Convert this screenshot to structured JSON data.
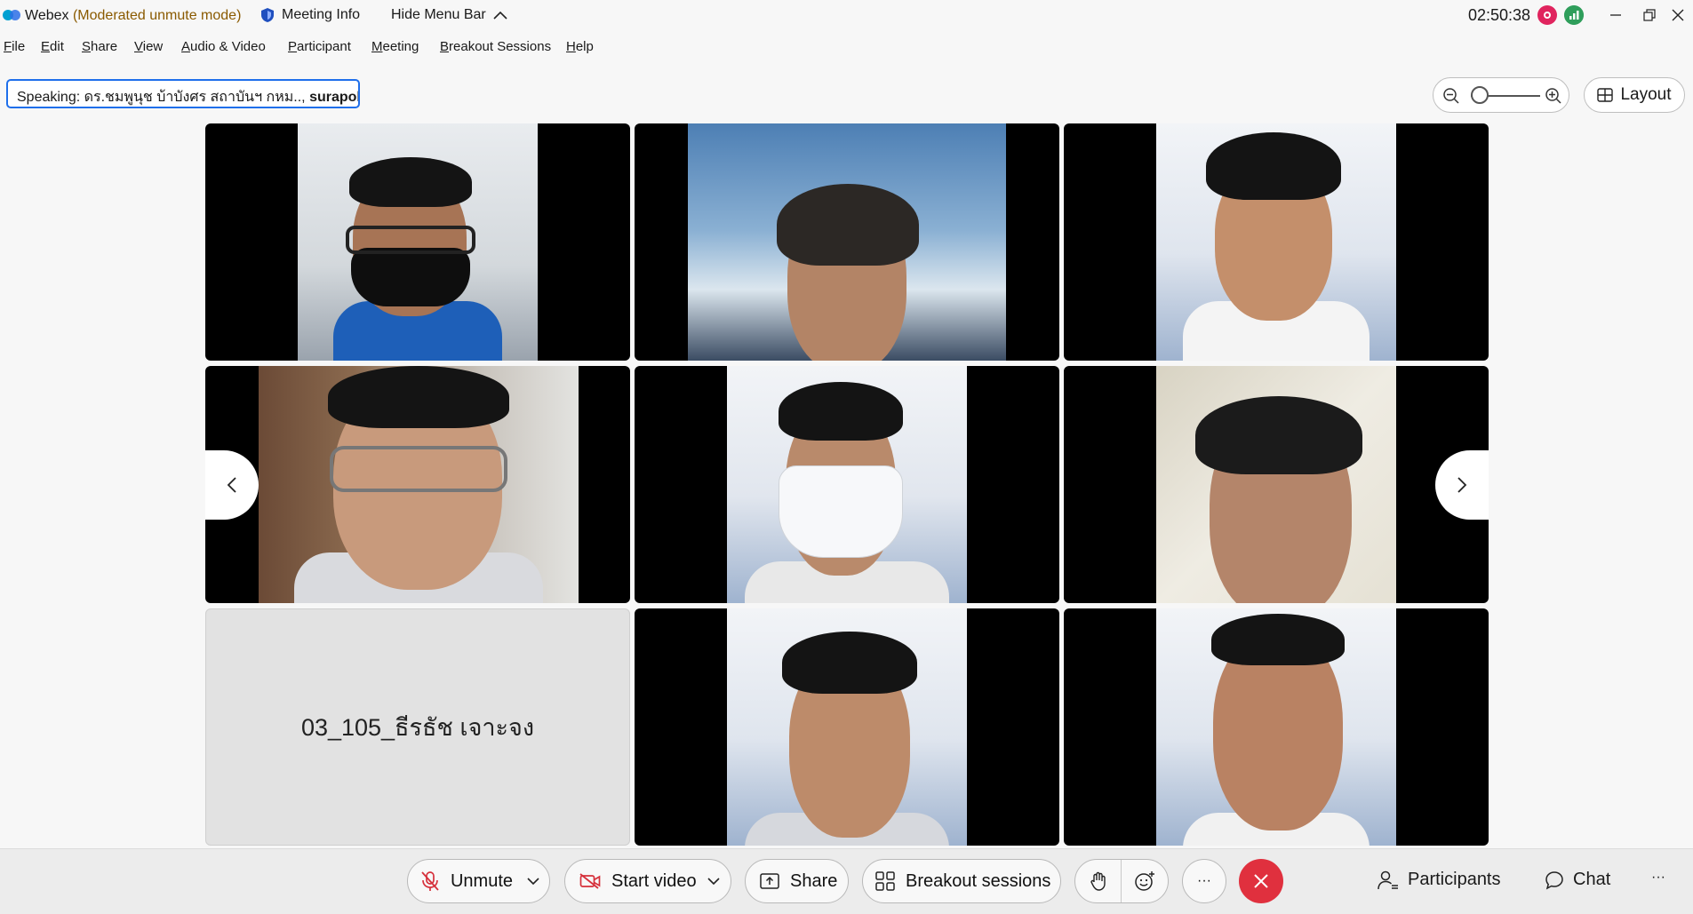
{
  "app": {
    "name": "Webex",
    "mode": "(Moderated unmute mode)",
    "meeting_info": "Meeting Info",
    "hide_menu_bar": "Hide Menu Bar",
    "clock": "02:50:38"
  },
  "menu": {
    "items": [
      {
        "first": "F",
        "rest": "ile"
      },
      {
        "first": "E",
        "rest": "dit"
      },
      {
        "first": "S",
        "rest": "hare"
      },
      {
        "first": "V",
        "rest": "iew"
      },
      {
        "first": "A",
        "rest": "udio & Video"
      },
      {
        "first": "P",
        "rest": "articipant"
      },
      {
        "first": "M",
        "rest": "eeting"
      },
      {
        "first": "B",
        "rest": "reakout Sessions"
      },
      {
        "first": "H",
        "rest": "elp"
      }
    ]
  },
  "speaking": {
    "prefix": "Speaking: ",
    "names": "ดร.ชมพูนุช บ้าบังศร สถาบันฯ กหม..,",
    "last": " surapol"
  },
  "layout_button": "Layout",
  "tiles": {
    "name_only": "03_105_ธีรธัช เจาะจง"
  },
  "colors": {
    "accent_blue": "#1f6feb",
    "end_red": "#e0303e",
    "bottom_bar": "#ececec"
  },
  "controls": {
    "unmute": "Unmute",
    "start_video": "Start video",
    "share": "Share",
    "breakout": "Breakout sessions",
    "more": "···",
    "participants": "Participants",
    "chat": "Chat",
    "overflow": "···"
  }
}
